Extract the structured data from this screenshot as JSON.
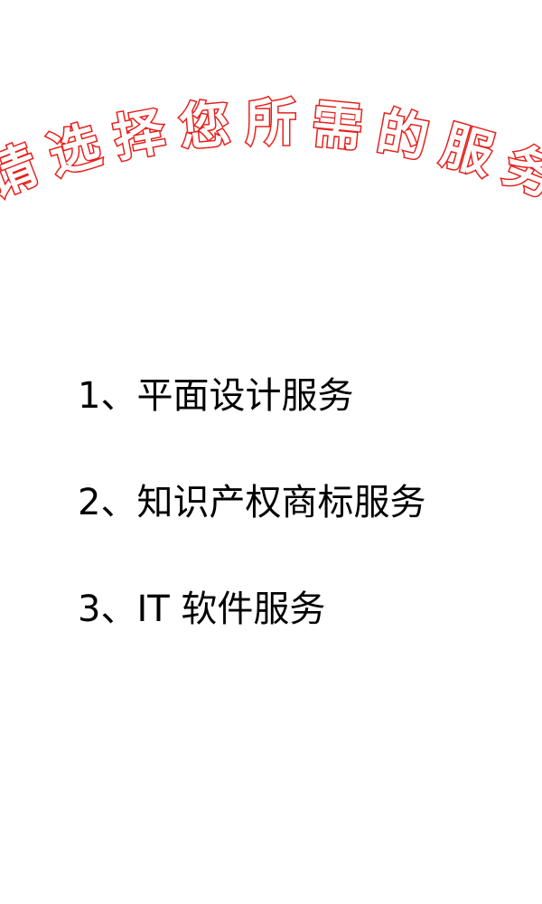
{
  "header": {
    "title_chars": [
      "请",
      "选",
      "择",
      "您",
      "所",
      "需",
      "的",
      "服",
      "务"
    ],
    "title_fill": "#ffffff",
    "title_stroke": "#e8201c"
  },
  "menu": {
    "items": [
      {
        "label": "1、平面设计服务"
      },
      {
        "label": "2、知识产权商标服务"
      },
      {
        "label": "3、IT 软件服务"
      }
    ]
  },
  "colors": {
    "background": "#ffffff",
    "text": "#000000"
  }
}
